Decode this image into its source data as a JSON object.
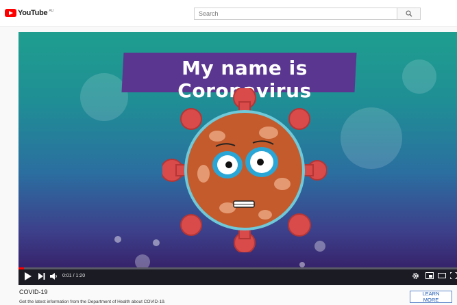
{
  "app": {
    "logo_text": "YouTube",
    "logo_country": "AU"
  },
  "search": {
    "placeholder": "Search",
    "icon": "search-icon"
  },
  "video": {
    "overlay_title": "My name is Coronavirus",
    "time": "0:01 / 1:20",
    "progress_fraction": 0.0125
  },
  "controls": {
    "icons": [
      "play-icon",
      "next-icon",
      "volume-icon",
      "settings-icon",
      "miniplayer-icon",
      "theater-mode-icon",
      "fullscreen-icon"
    ]
  },
  "info_panel": {
    "title": "COVID-19",
    "description": "Get the latest information from the Department of Health about COVID-19.",
    "button_label": "LEARN MORE"
  },
  "colors": {
    "brand_red": "#ff0000",
    "banner_purple": "#5a3690",
    "link_blue": "#1a56b0"
  }
}
